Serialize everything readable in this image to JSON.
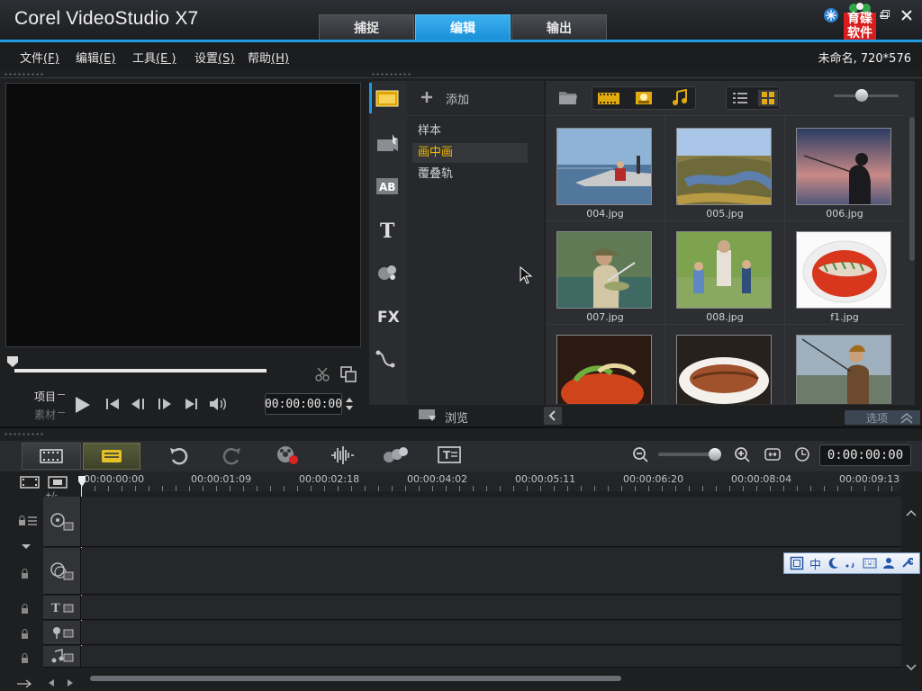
{
  "app": {
    "title": "Corel VideoStudio X7",
    "tabs": [
      {
        "label": "捕捉"
      },
      {
        "label": "编辑",
        "active": true
      },
      {
        "label": "输出"
      }
    ],
    "logo_text": [
      "育碟",
      "软件"
    ],
    "accent_color": "#1f9ae2",
    "selected_color": "#f2b900"
  },
  "menu": {
    "items": [
      {
        "label": "文件",
        "key": "(F)"
      },
      {
        "label": "编辑",
        "key": "(E)"
      },
      {
        "label": "工具",
        "key": "(E )"
      },
      {
        "label": "设置",
        "key": "(S)"
      },
      {
        "label": "帮助",
        "key": "(H)"
      }
    ],
    "project_info": "未命名, 720*576"
  },
  "player": {
    "mode_project": "项目",
    "mode_clip": "素材",
    "timecode": "00:00:00:00"
  },
  "library": {
    "add_label": "添加",
    "folders": [
      {
        "label": "样本",
        "selected": false
      },
      {
        "label": "画中画",
        "selected": true
      },
      {
        "label": "覆叠轨",
        "selected": false
      }
    ],
    "browse_label": "浏览",
    "options_label": "选项",
    "media": [
      {
        "label": "004.jpg",
        "scene": "fishing-boat"
      },
      {
        "label": "005.jpg",
        "scene": "landscape"
      },
      {
        "label": "006.jpg",
        "scene": "fisher-sunset"
      },
      {
        "label": "007.jpg",
        "scene": "fish-catch"
      },
      {
        "label": "008.jpg",
        "scene": "family"
      },
      {
        "label": "f1.jpg",
        "scene": "fish-dish"
      },
      {
        "label": "",
        "scene": "food"
      },
      {
        "label": "",
        "scene": "fish-plate"
      },
      {
        "label": "",
        "scene": "fisherman"
      }
    ]
  },
  "timeline": {
    "timecode": "0:00:00:00",
    "ruler": [
      "00:00:00:00",
      "00:00:01:09",
      "00:00:02:18",
      "00:00:04:02",
      "00:00:05:11",
      "00:00:06:20",
      "00:00:08:04",
      "00:00:09:13"
    ],
    "add_remove": "+/-"
  },
  "ime": {
    "mode": "中"
  }
}
